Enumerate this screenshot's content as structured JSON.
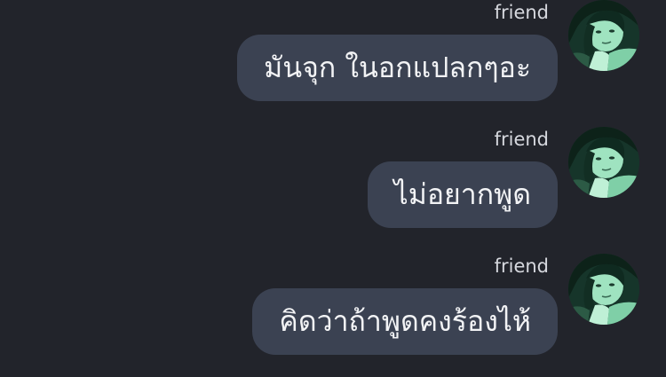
{
  "chat": {
    "messages": [
      {
        "sender": "friend",
        "text": "มันจุก ในอกแปลกๆอะ",
        "avatar_icon": "avatar-photo"
      },
      {
        "sender": "friend",
        "text": "ไม่อยากพูด",
        "avatar_icon": "avatar-photo"
      },
      {
        "sender": "friend",
        "text": "คิดว่าถ้าพูดคงร้องไห้",
        "avatar_icon": "avatar-photo"
      }
    ]
  },
  "colors": {
    "background": "#22242b",
    "bubble": "#3b4252",
    "text": "#f2f3f5",
    "sender": "#d6d8de",
    "avatar_tint": "#9fe3c0"
  }
}
